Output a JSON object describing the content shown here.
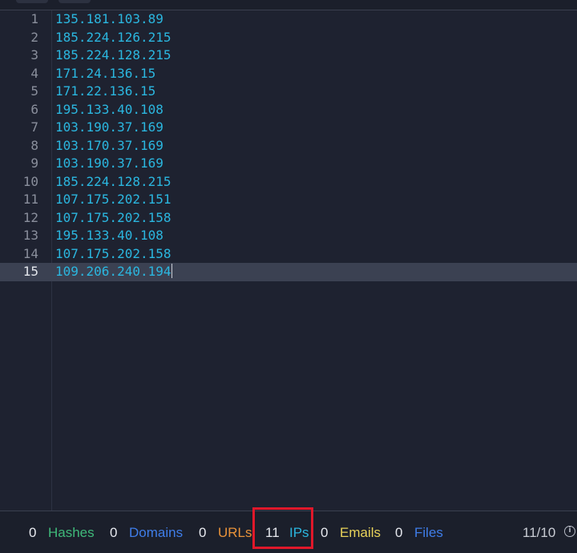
{
  "editor": {
    "lines": [
      {
        "num": "1",
        "text": "135.181.103.89"
      },
      {
        "num": "2",
        "text": "185.224.126.215"
      },
      {
        "num": "3",
        "text": "185.224.128.215"
      },
      {
        "num": "4",
        "text": "171.24.136.15"
      },
      {
        "num": "5",
        "text": "171.22.136.15"
      },
      {
        "num": "6",
        "text": "195.133.40.108"
      },
      {
        "num": "7",
        "text": "103.190.37.169"
      },
      {
        "num": "8",
        "text": "103.170.37.169"
      },
      {
        "num": "9",
        "text": "103.190.37.169"
      },
      {
        "num": "10",
        "text": "185.224.128.215"
      },
      {
        "num": "11",
        "text": "107.175.202.151"
      },
      {
        "num": "12",
        "text": "107.175.202.158"
      },
      {
        "num": "13",
        "text": "195.133.40.108"
      },
      {
        "num": "14",
        "text": "107.175.202.158"
      },
      {
        "num": "15",
        "text": "109.206.240.194"
      }
    ],
    "active_line": 15
  },
  "status": {
    "hashes": {
      "count": "0",
      "label": "Hashes"
    },
    "domains": {
      "count": "0",
      "label": "Domains"
    },
    "urls": {
      "count": "0",
      "label": "URLs"
    },
    "ips": {
      "count": "11",
      "label": "IPs"
    },
    "emails": {
      "count": "0",
      "label": "Emails"
    },
    "files": {
      "count": "0",
      "label": "Files"
    },
    "ratio": "11/10",
    "info_icon": "info-icon"
  },
  "colors": {
    "background": "#1e2230",
    "ip_text": "#2bb7e0",
    "hashes": "#3fb97a",
    "domains": "#3f7de8",
    "urls": "#e8923a",
    "emails": "#e8d25a",
    "highlight": "#e0182a"
  }
}
